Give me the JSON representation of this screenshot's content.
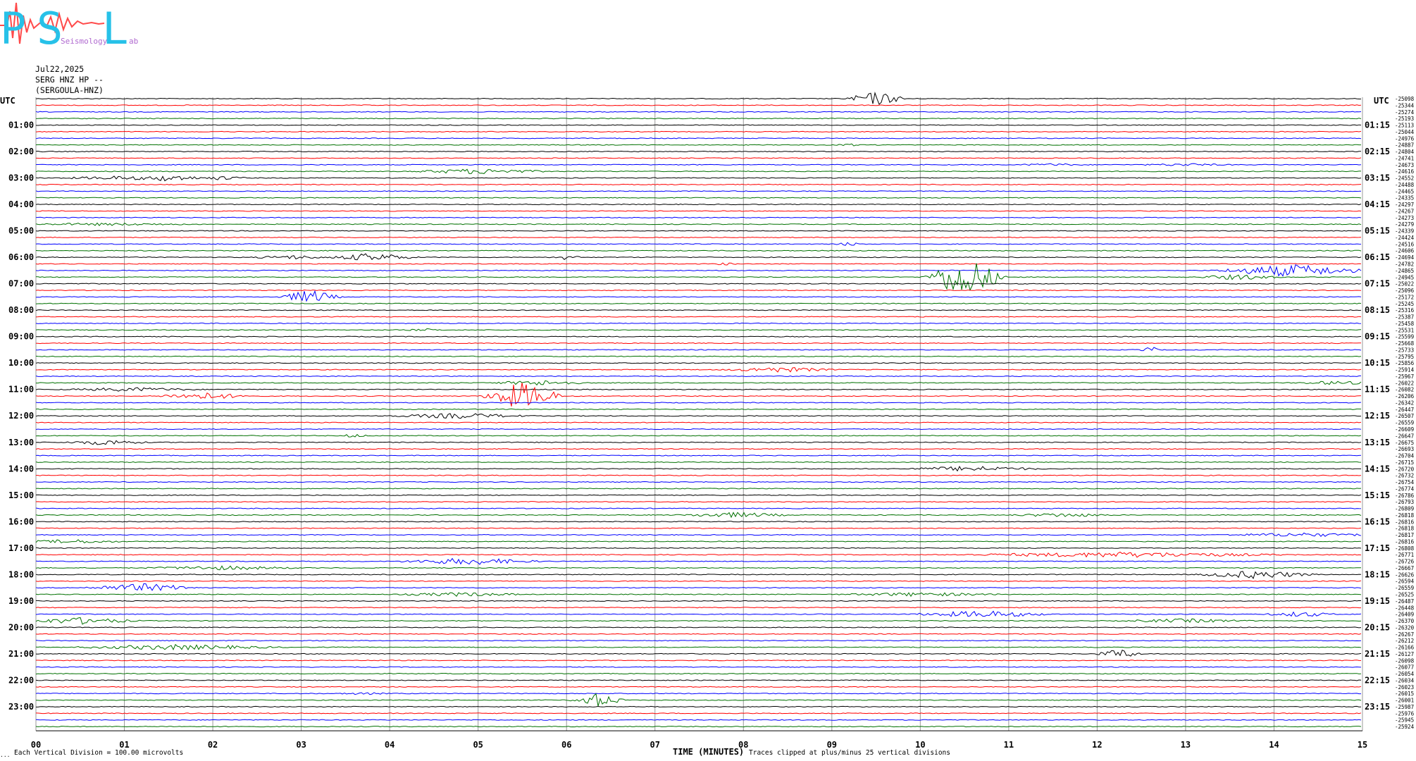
{
  "logo": {
    "letters": [
      "P",
      "S",
      "L"
    ],
    "small_words": [
      "Seismology",
      "ab"
    ],
    "colors": {
      "letters": "#27c1e8",
      "squiggle": "#ff4a4a"
    }
  },
  "header": {
    "date": "Jul22,2025",
    "station": "SERG HNZ HP --",
    "station_name": "(SERGOULA-HNZ)"
  },
  "chart_data": {
    "type": "line",
    "title": "",
    "xlabel": "TIME (MINUTES)",
    "ylabel": "UTC",
    "right_ylabel": "UTC",
    "xlim": [
      0,
      15
    ],
    "x_ticks": [
      "00",
      "01",
      "02",
      "03",
      "04",
      "05",
      "06",
      "07",
      "08",
      "09",
      "10",
      "11",
      "12",
      "13",
      "14",
      "15"
    ],
    "left_hour_labels": [
      "01:00",
      "02:00",
      "03:00",
      "04:00",
      "05:00",
      "06:00",
      "07:00",
      "08:00",
      "09:00",
      "10:00",
      "11:00",
      "12:00",
      "13:00",
      "14:00",
      "15:00",
      "16:00",
      "17:00",
      "18:00",
      "19:00",
      "20:00",
      "21:00",
      "22:00",
      "23:00"
    ],
    "right_hour_labels": [
      "01:15",
      "02:15",
      "03:15",
      "04:15",
      "05:15",
      "06:15",
      "07:15",
      "08:15",
      "09:15",
      "10:15",
      "11:15",
      "12:15",
      "13:15",
      "14:15",
      "15:15",
      "16:15",
      "17:15",
      "18:15",
      "19:15",
      "20:15",
      "21:15",
      "22:15",
      "23:15"
    ],
    "trace_colors": [
      "#000000",
      "#ff0000",
      "#0000ff",
      "#007000"
    ],
    "traces_per_hour": 4,
    "trace_count": 96,
    "trace_offsets": [
      "-25098",
      "-25344",
      "-25274",
      "-25193",
      "-25113",
      "-25044",
      "-24976",
      "-24887",
      "-24804",
      "-24741",
      "-24673",
      "-24616",
      "-24552",
      "-24488",
      "-24465",
      "-24335",
      "-24297",
      "-24267",
      "-24273",
      "-24279",
      "-24339",
      "-24424",
      "-24516",
      "-24606",
      "-24694",
      "-24782",
      "-24865",
      "-24945",
      "-25022",
      "-25096",
      "-25172",
      "-25245",
      "-25316",
      "-25387",
      "-25458",
      "-25531",
      "-25599",
      "-25668",
      "-25733",
      "-25795",
      "-25856",
      "-25914",
      "-25967",
      "-26022",
      "-26082",
      "-26206",
      "-26342",
      "-26447",
      "-26507",
      "-26559",
      "-26609",
      "-26647",
      "-26675",
      "-26693",
      "-26704",
      "-26715",
      "-26720",
      "-26732",
      "-26754",
      "-26774",
      "-26786",
      "-26793",
      "-26809",
      "-26818",
      "-26816",
      "-26818",
      "-26817",
      "-26816",
      "-26808",
      "-26771",
      "-26726",
      "-26667",
      "-26626",
      "-26594",
      "-26559",
      "-26525",
      "-26487",
      "-26448",
      "-26409",
      "-26370",
      "-26320",
      "-26267",
      "-26212",
      "-26166",
      "-26127",
      "-26098",
      "-26077",
      "-26054",
      "-26034",
      "-26023",
      "-26015",
      "-26001",
      "-25987",
      "-25976",
      "-25945",
      "-25924"
    ],
    "events": [
      {
        "trace": 0,
        "minute": 9.5,
        "amplitude": 10,
        "duration": 0.4
      },
      {
        "trace": 7,
        "minute": 9.2,
        "amplitude": 2,
        "duration": 0.2
      },
      {
        "trace": 10,
        "minute": 11.5,
        "amplitude": 2,
        "duration": 0.6
      },
      {
        "trace": 10,
        "minute": 13.0,
        "amplitude": 2,
        "duration": 0.8
      },
      {
        "trace": 11,
        "minute": 5.0,
        "amplitude": 4,
        "duration": 1.0
      },
      {
        "trace": 12,
        "minute": 1.0,
        "amplitude": 3,
        "duration": 1.0
      },
      {
        "trace": 12,
        "minute": 1.5,
        "amplitude": 5,
        "duration": 0.5
      },
      {
        "trace": 12,
        "minute": 2.1,
        "amplitude": 3,
        "duration": 0.4
      },
      {
        "trace": 19,
        "minute": 0.8,
        "amplitude": 2,
        "duration": 1.5
      },
      {
        "trace": 22,
        "minute": 9.2,
        "amplitude": 3,
        "duration": 0.2
      },
      {
        "trace": 24,
        "minute": 2.9,
        "amplitude": 3,
        "duration": 0.6
      },
      {
        "trace": 24,
        "minute": 3.8,
        "amplitude": 6,
        "duration": 0.6
      },
      {
        "trace": 24,
        "minute": 6.0,
        "amplitude": 4,
        "duration": 0.2
      },
      {
        "trace": 25,
        "minute": 7.8,
        "amplitude": 2,
        "duration": 0.2
      },
      {
        "trace": 26,
        "minute": 14.2,
        "amplitude": 9,
        "duration": 1.0
      },
      {
        "trace": 27,
        "minute": 13.6,
        "amplitude": 4,
        "duration": 0.6
      },
      {
        "trace": 27,
        "minute": 10.5,
        "amplitude": 30,
        "duration": 0.5
      },
      {
        "trace": 30,
        "minute": 3.1,
        "amplitude": 10,
        "duration": 0.4
      },
      {
        "trace": 35,
        "minute": 4.4,
        "amplitude": 2,
        "duration": 0.3
      },
      {
        "trace": 38,
        "minute": 12.6,
        "amplitude": 5,
        "duration": 0.15
      },
      {
        "trace": 41,
        "minute": 8.4,
        "amplitude": 4,
        "duration": 0.8
      },
      {
        "trace": 43,
        "minute": 5.7,
        "amplitude": 4,
        "duration": 0.7
      },
      {
        "trace": 43,
        "minute": 14.7,
        "amplitude": 3,
        "duration": 0.6
      },
      {
        "trace": 44,
        "minute": 1.1,
        "amplitude": 3,
        "duration": 1.0
      },
      {
        "trace": 45,
        "minute": 5.5,
        "amplitude": 20,
        "duration": 0.5
      },
      {
        "trace": 45,
        "minute": 1.9,
        "amplitude": 5,
        "duration": 0.7
      },
      {
        "trace": 48,
        "minute": 4.8,
        "amplitude": 4,
        "duration": 1.0
      },
      {
        "trace": 51,
        "minute": 3.6,
        "amplitude": 3,
        "duration": 0.2
      },
      {
        "trace": 52,
        "minute": 0.8,
        "amplitude": 4,
        "duration": 0.6
      },
      {
        "trace": 56,
        "minute": 10.6,
        "amplitude": 4,
        "duration": 1.0
      },
      {
        "trace": 63,
        "minute": 7.9,
        "amplitude": 4,
        "duration": 0.8
      },
      {
        "trace": 63,
        "minute": 11.6,
        "amplitude": 3,
        "duration": 0.8
      },
      {
        "trace": 66,
        "minute": 14.3,
        "amplitude": 3,
        "duration": 1.2
      },
      {
        "trace": 67,
        "minute": 0.4,
        "amplitude": 3,
        "duration": 0.8
      },
      {
        "trace": 69,
        "minute": 12.3,
        "amplitude": 4,
        "duration": 2.4
      },
      {
        "trace": 70,
        "minute": 4.9,
        "amplitude": 5,
        "duration": 1.0
      },
      {
        "trace": 71,
        "minute": 2.1,
        "amplitude": 3,
        "duration": 1.2
      },
      {
        "trace": 72,
        "minute": 13.8,
        "amplitude": 6,
        "duration": 0.8
      },
      {
        "trace": 74,
        "minute": 1.2,
        "amplitude": 6,
        "duration": 0.8
      },
      {
        "trace": 75,
        "minute": 10.0,
        "amplitude": 3,
        "duration": 1.2
      },
      {
        "trace": 75,
        "minute": 4.8,
        "amplitude": 3,
        "duration": 1.0
      },
      {
        "trace": 78,
        "minute": 10.7,
        "amplitude": 5,
        "duration": 1.0
      },
      {
        "trace": 78,
        "minute": 14.3,
        "amplitude": 4,
        "duration": 0.5
      },
      {
        "trace": 79,
        "minute": 0.5,
        "amplitude": 5,
        "duration": 0.8
      },
      {
        "trace": 79,
        "minute": 13.0,
        "amplitude": 3,
        "duration": 1.0
      },
      {
        "trace": 83,
        "minute": 1.6,
        "amplitude": 4,
        "duration": 1.5
      },
      {
        "trace": 84,
        "minute": 12.25,
        "amplitude": 7,
        "duration": 0.3
      },
      {
        "trace": 90,
        "minute": 3.7,
        "amplitude": 2,
        "duration": 0.4
      },
      {
        "trace": 91,
        "minute": 6.35,
        "amplitude": 10,
        "duration": 0.35
      }
    ],
    "clipping_note": "Traces clipped at plus/minus 25 vertical divisions"
  },
  "footer": {
    "scale_note": "Each Vertical Division =  100.00 microvolts",
    "corner_mark": "..."
  }
}
